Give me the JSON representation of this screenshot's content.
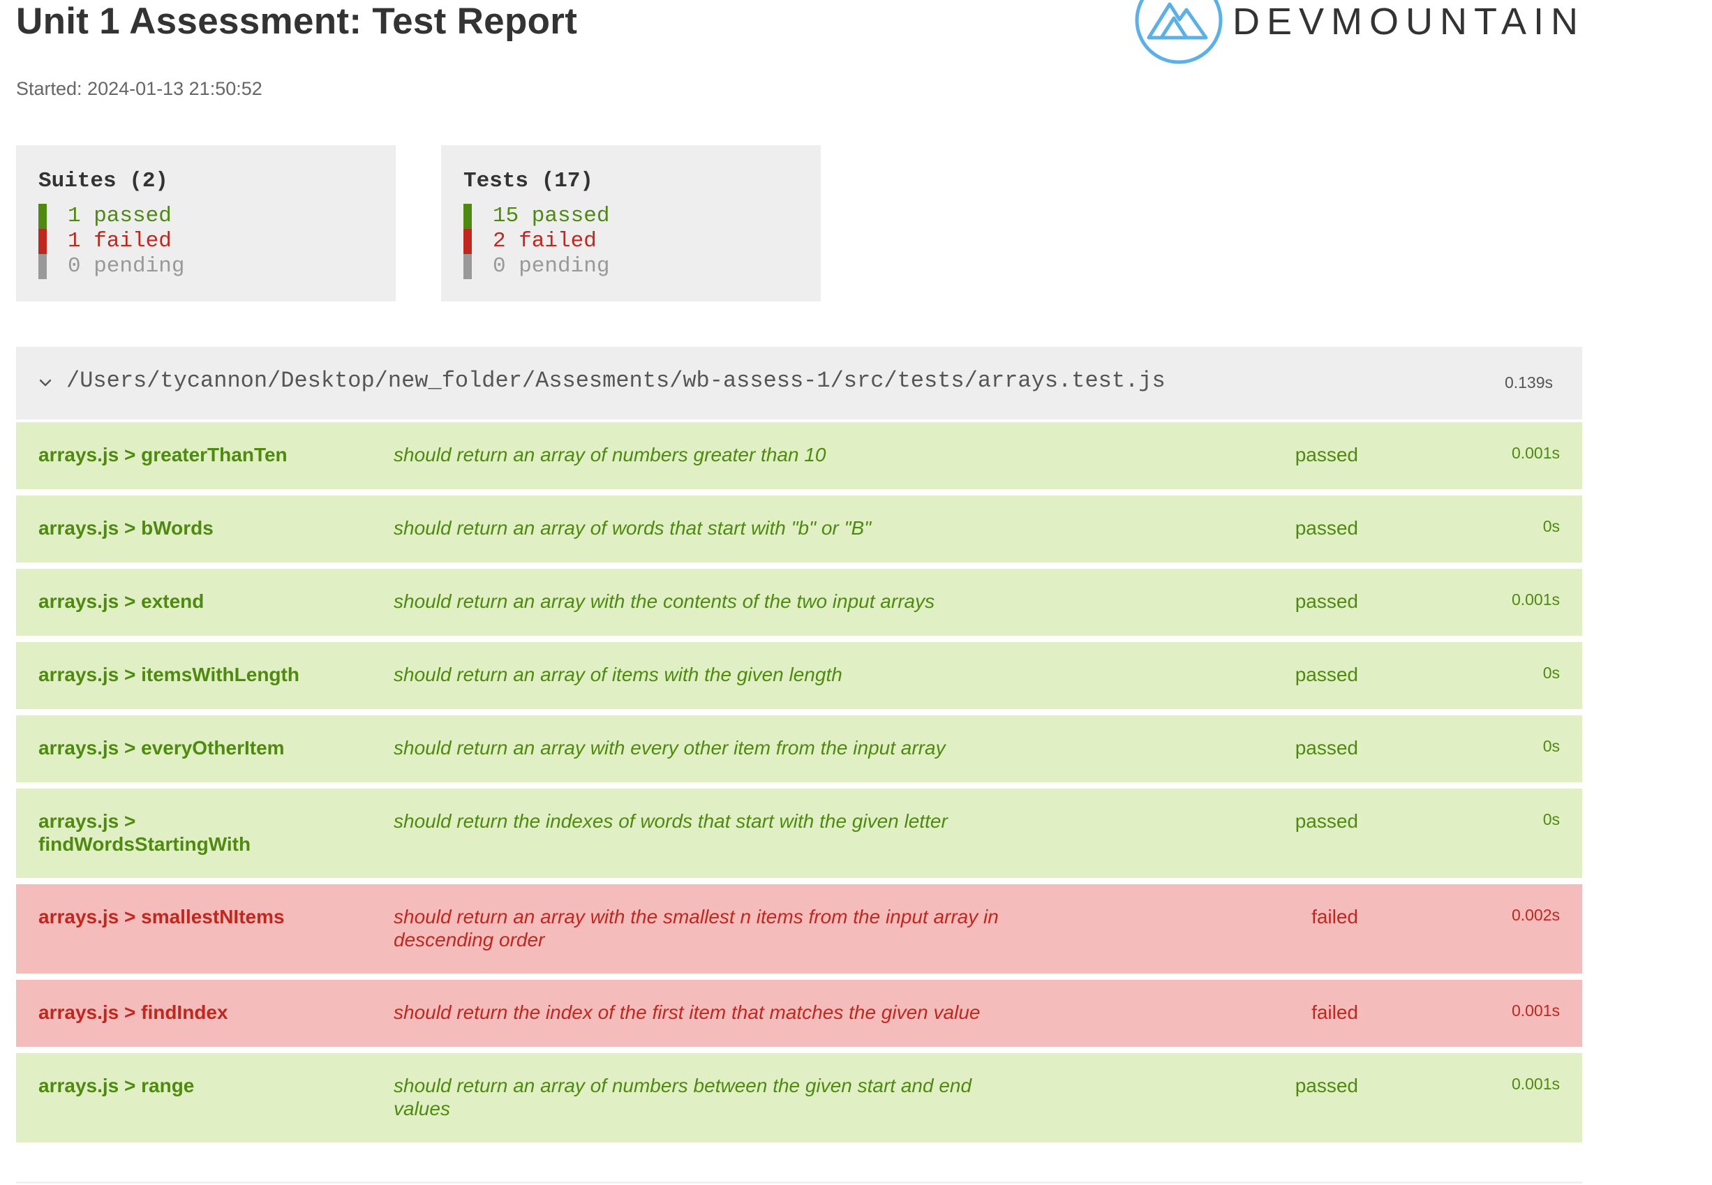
{
  "header": {
    "title": "Unit 1 Assessment: Test Report",
    "started": "Started: 2024-01-13 21:50:52",
    "logo_text": "DEVMOUNTAIN",
    "logo_icon": "mountain-logo-icon"
  },
  "summary": {
    "suites": {
      "title": "Suites (2)",
      "passed": "1 passed",
      "failed": "1 failed",
      "pending": "0 pending"
    },
    "tests": {
      "title": "Tests (17)",
      "passed": "15 passed",
      "failed": "2 failed",
      "pending": "0 pending"
    }
  },
  "suite": {
    "path": "/Users/tycannon/Desktop/new_folder/Assesments/wb-assess-1/src/tests/arrays.test.js",
    "time": "0.139s",
    "expand_icon": "chevron-down-icon"
  },
  "results": [
    {
      "name": "arrays.js > greaterThanTen",
      "description": "should return an array of numbers greater than 10",
      "status": "passed",
      "time": "0.001s"
    },
    {
      "name": "arrays.js > bWords",
      "description": "should return an array of words that start with \"b\" or \"B\"",
      "status": "passed",
      "time": "0s"
    },
    {
      "name": "arrays.js > extend",
      "description": "should return an array with the contents of the two input arrays",
      "status": "passed",
      "time": "0.001s"
    },
    {
      "name": "arrays.js > itemsWithLength",
      "description": "should return an array of items with the given length",
      "status": "passed",
      "time": "0s"
    },
    {
      "name": "arrays.js > everyOtherItem",
      "description": "should return an array with every other item from the input array",
      "status": "passed",
      "time": "0s"
    },
    {
      "name": "arrays.js > findWordsStartingWith",
      "description": "should return the indexes of words that start with the given letter",
      "status": "passed",
      "time": "0s"
    },
    {
      "name": "arrays.js > smallestNItems",
      "description": "should return an array with the smallest n items from the input array in descending order",
      "status": "failed",
      "time": "0.002s"
    },
    {
      "name": "arrays.js > findIndex",
      "description": "should return the index of the first item that matches the given value",
      "status": "failed",
      "time": "0.001s"
    },
    {
      "name": "arrays.js > range",
      "description": "should return an array of numbers between the given start and end values",
      "status": "passed",
      "time": "0.001s"
    }
  ],
  "colors": {
    "passed_bg": "#e1f0c4",
    "passed_text": "#4f8a10",
    "failed_bg": "#f5bcbc",
    "failed_text": "#c0271f",
    "pending_text": "#999999",
    "logo_blue": "#5bb0e8"
  }
}
